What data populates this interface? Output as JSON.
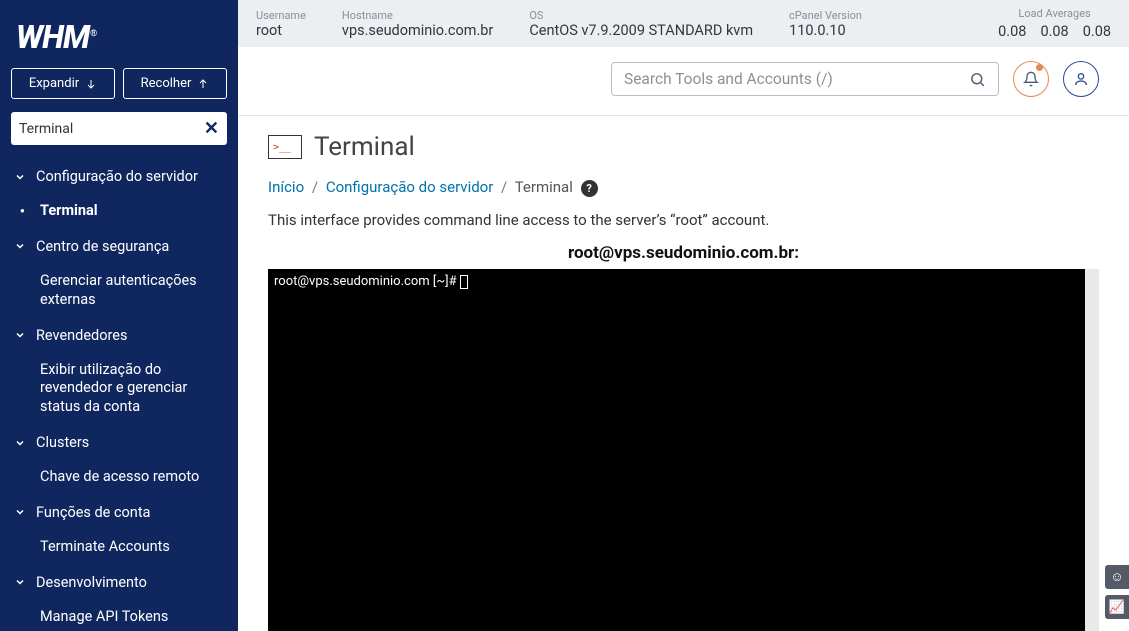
{
  "logo": "WHM",
  "sidebar": {
    "expand": "Expandir",
    "collapse": "Recolher",
    "search_value": "Terminal",
    "groups": [
      {
        "label": "Configuração do servidor",
        "items": [
          {
            "label": "Terminal",
            "active": true
          }
        ]
      },
      {
        "label": "Centro de segurança",
        "items": [
          {
            "label": "Gerenciar autenticações externas"
          }
        ]
      },
      {
        "label": "Revendedores",
        "items": [
          {
            "label": "Exibir utilização do revendedor e gerenciar status da conta"
          }
        ]
      },
      {
        "label": "Clusters",
        "items": [
          {
            "label": "Chave de acesso remoto"
          }
        ]
      },
      {
        "label": "Funções de conta",
        "items": [
          {
            "label": "Terminate Accounts"
          }
        ]
      },
      {
        "label": "Desenvolvimento",
        "items": [
          {
            "label": "Manage API Tokens"
          }
        ]
      }
    ]
  },
  "topbar": {
    "username_lbl": "Username",
    "username": "root",
    "hostname_lbl": "Hostname",
    "hostname": "vps.seudominio.com.br",
    "os_lbl": "OS",
    "os": "CentOS v7.9.2009 STANDARD kvm",
    "cpver_lbl": "cPanel Version",
    "cpver": "110.0.10",
    "load_lbl": "Load Averages",
    "load1": "0.08",
    "load2": "0.08",
    "load3": "0.08"
  },
  "header": {
    "search_placeholder": "Search Tools and Accounts (/)"
  },
  "page": {
    "title": "Terminal",
    "breadcrumb_home": "Início",
    "breadcrumb_cat": "Configuração do servidor",
    "breadcrumb_cur": "Terminal",
    "description": "This interface provides command line access to the server’s “root” account.",
    "term_title": "root@vps.seudominio.com.br:",
    "prompt": "root@vps.seudominio.com [~]# "
  }
}
